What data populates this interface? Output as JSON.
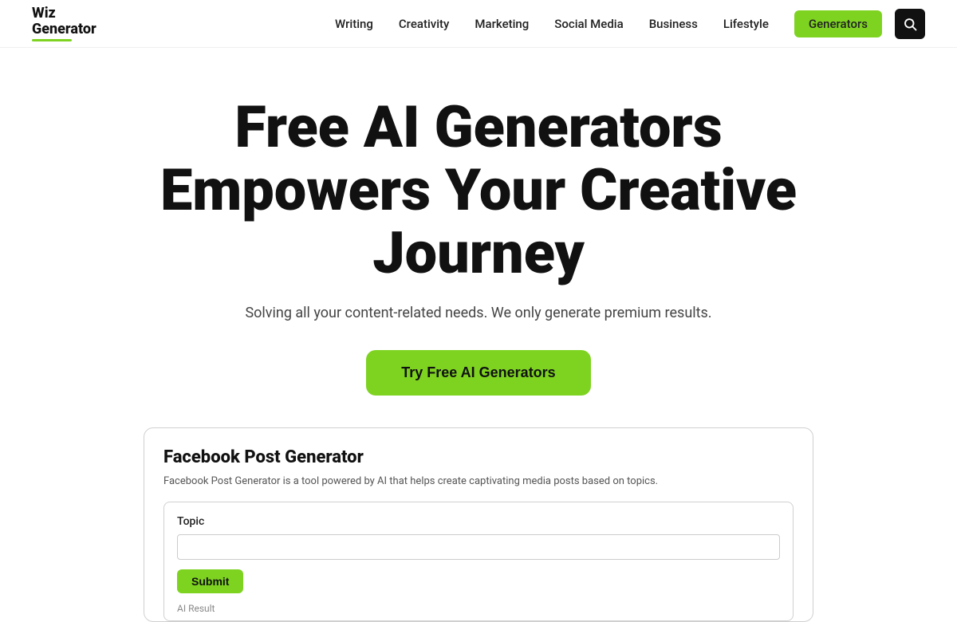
{
  "logo": {
    "line1": "Wiz",
    "line2": "Generator"
  },
  "nav": {
    "links": [
      {
        "label": "Writing",
        "href": "#"
      },
      {
        "label": "Creativity",
        "href": "#"
      },
      {
        "label": "Marketing",
        "href": "#"
      },
      {
        "label": "Social Media",
        "href": "#"
      },
      {
        "label": "Business",
        "href": "#"
      },
      {
        "label": "Lifestyle",
        "href": "#"
      }
    ],
    "generators_label": "Generators"
  },
  "hero": {
    "title": "Free AI Generators Empowers Your Creative Journey",
    "subtitle": "Solving all your content-related needs. We only generate premium results.",
    "cta_label": "Try Free AI Generators"
  },
  "demo_card": {
    "title": "Facebook Post Generator",
    "description": "Facebook Post Generator is a tool powered by AI that helps create captivating media posts based on topics.",
    "topic_label": "Topic",
    "submit_label": "Submit",
    "result_label": "AI Result"
  },
  "colors": {
    "accent": "#7ed321",
    "dark": "#111111",
    "text": "#444444"
  }
}
